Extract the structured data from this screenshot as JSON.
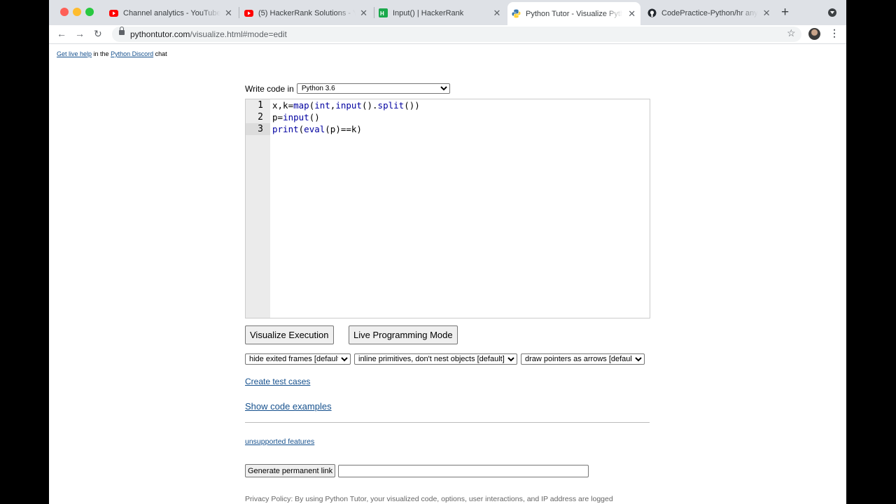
{
  "browser": {
    "tabs": [
      {
        "title": "Channel analytics - YouTube Studio",
        "icon": "youtube-icon"
      },
      {
        "title": "(5) HackerRank Solutions - YouTube",
        "icon": "youtube-icon"
      },
      {
        "title": "Input() | HackerRank",
        "icon": "hackerrank-icon"
      },
      {
        "title": "Python Tutor - Visualize Python",
        "icon": "python-icon",
        "active": true
      },
      {
        "title": "CodePractice-Python/hr any or all",
        "icon": "github-icon"
      }
    ],
    "url_host": "pythontutor.com",
    "url_path": "/visualize.html#mode=edit"
  },
  "page": {
    "help": {
      "link1": "Get live help",
      "mid": " in the ",
      "link2": "Python Discord",
      "end": " chat"
    },
    "write_code_label": "Write code in",
    "language": "Python 3.6",
    "editor": {
      "line_numbers": [
        "1",
        "2",
        "3"
      ],
      "lines": [
        "x,k=map(int,input().split())",
        "p=input()",
        "print(eval(p)==k)"
      ]
    },
    "visualize_button": "Visualize Execution",
    "live_button": "Live Programming Mode",
    "options": [
      "hide exited frames [default]",
      "inline primitives, don't nest objects [default]",
      "draw pointers as arrows [default]"
    ],
    "create_test_cases": "Create test cases",
    "show_examples": "Show code examples",
    "unsupported": "unsupported features",
    "permalink_button": "Generate permanent link",
    "privacy": "Privacy Policy: By using Python Tutor, your visualized code, options, user interactions, and IP address are logged"
  },
  "colors": {
    "link": "#15508d",
    "keyword": "#0000a0",
    "tab_bg": "#dee1e6"
  }
}
